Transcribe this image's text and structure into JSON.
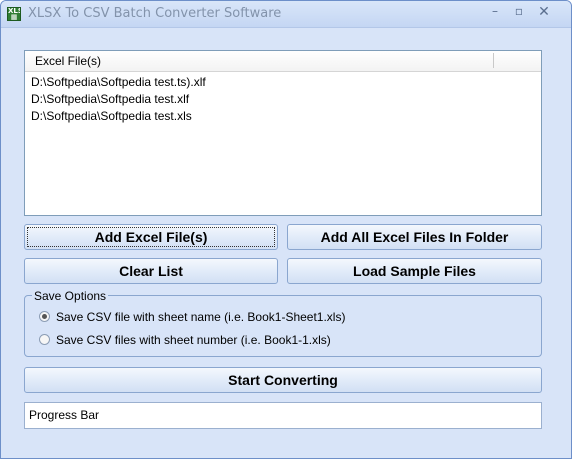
{
  "window": {
    "title": "XLSX To CSV Batch Converter Software",
    "icon": "spreadsheet-icon",
    "controls": {
      "minimize": "minimize-icon",
      "maximize": "maximize-icon",
      "close": "close-icon"
    }
  },
  "file_list": {
    "column_header": "Excel File(s)",
    "items": [
      "D:\\Softpedia\\Softpedia test.ts).xlf",
      "D:\\Softpedia\\Softpedia test.xlf",
      "D:\\Softpedia\\Softpedia test.xls"
    ]
  },
  "buttons": {
    "add_files": "Add Excel File(s)",
    "add_folder": "Add All Excel Files In Folder",
    "clear_list": "Clear List",
    "load_samples": "Load Sample Files",
    "start": "Start Converting"
  },
  "save_options": {
    "label": "Save Options",
    "options": [
      {
        "label": "Save CSV file with sheet name (i.e. Book1-Sheet1.xls)",
        "selected": true
      },
      {
        "label": "Save CSV files with sheet number (i.e. Book1-1.xls)",
        "selected": false
      }
    ]
  },
  "progress": {
    "text": "Progress Bar"
  },
  "colors": {
    "window_bg": "#d8e4f8",
    "border": "#8aa6cf"
  }
}
